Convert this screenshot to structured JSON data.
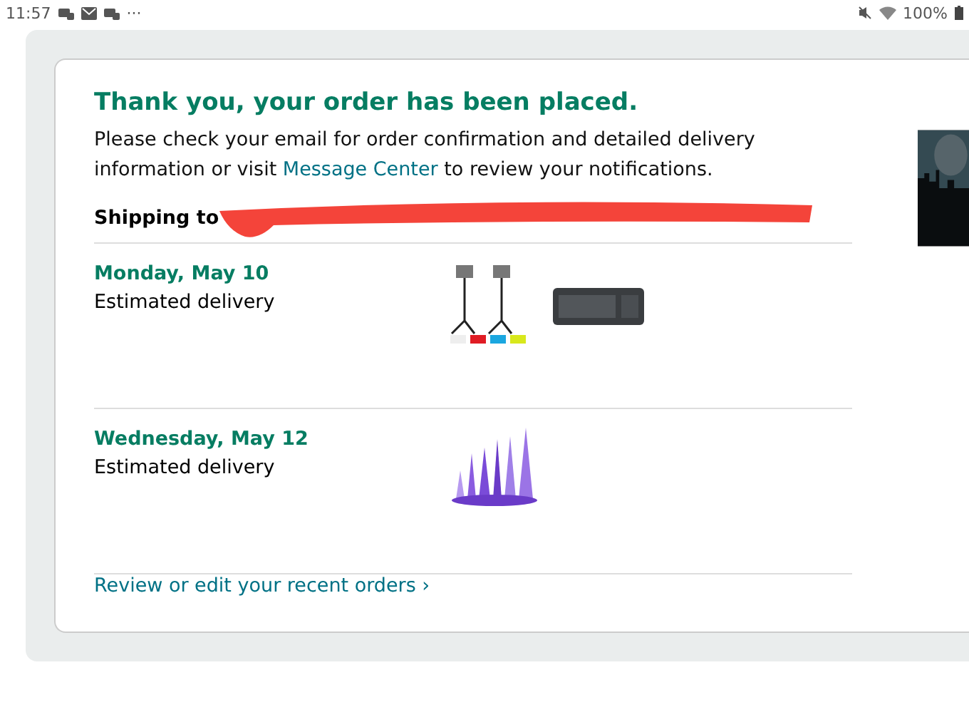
{
  "status_bar": {
    "time": "11:57",
    "more": "···",
    "battery": "100%"
  },
  "confirmation": {
    "title": "Thank you, your order has been placed.",
    "message_before": "Please check your email for order confirmation and detailed delivery information or visit ",
    "link": "Message Center",
    "message_after": " to review your notifications.",
    "shipping_label": "Shipping to"
  },
  "deliveries": [
    {
      "date": "Monday, May 10",
      "status": "Estimated delivery",
      "items": [
        {
          "kind": "lights"
        },
        {
          "kind": "keyboard"
        }
      ]
    },
    {
      "date": "Wednesday, May 12",
      "status": "Estimated delivery",
      "items": [
        {
          "kind": "purple"
        }
      ]
    }
  ],
  "footer_link": "Review or edit your recent orders ›"
}
